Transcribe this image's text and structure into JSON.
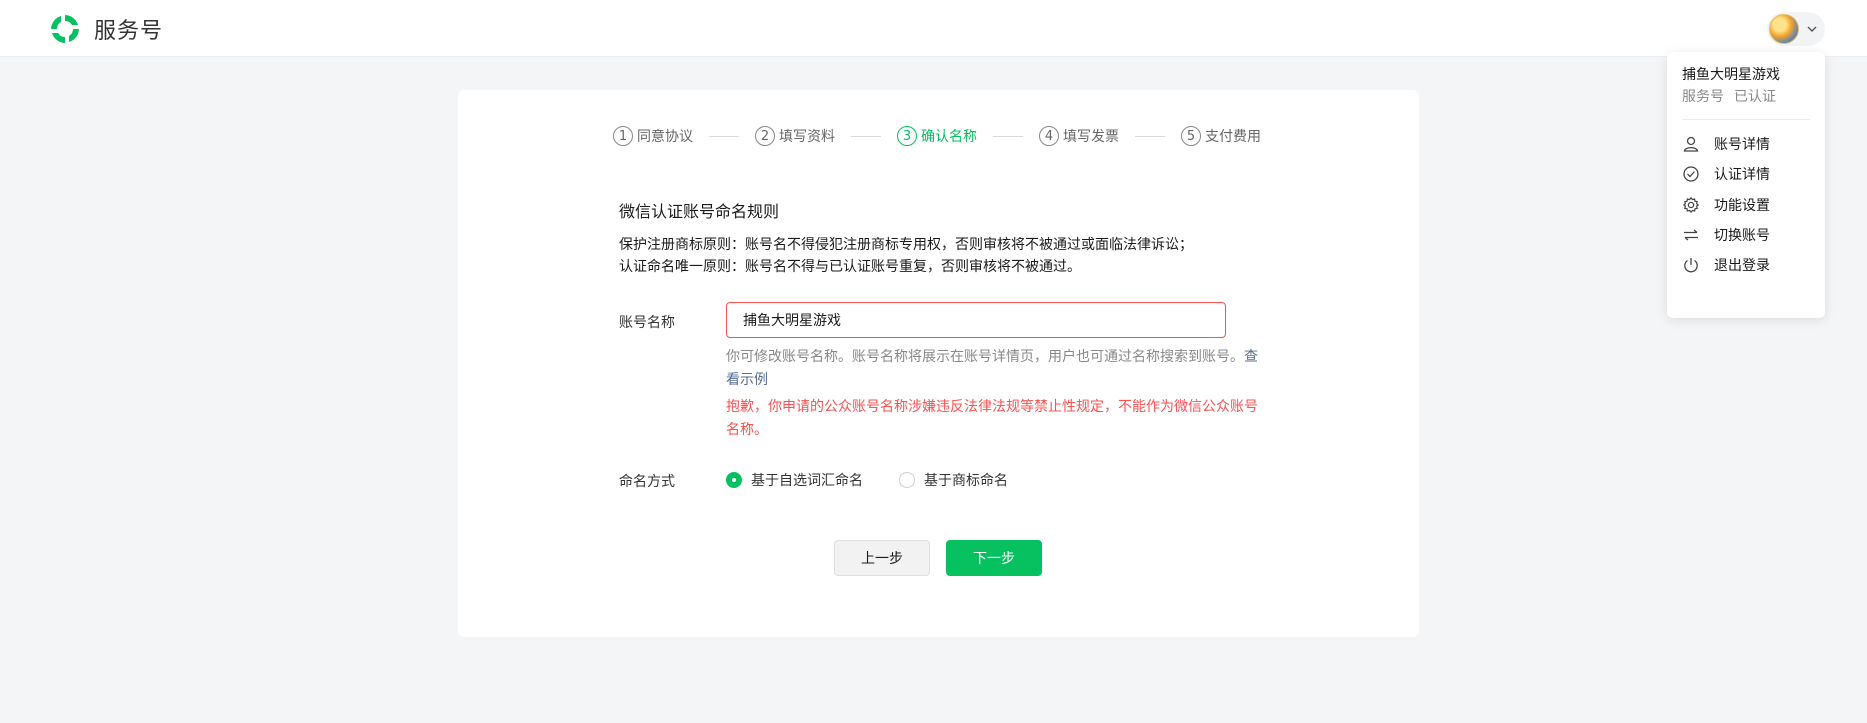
{
  "header": {
    "brand_name": "服务号"
  },
  "steps": [
    {
      "num": "1",
      "label": "同意协议",
      "active": false
    },
    {
      "num": "2",
      "label": "填写资料",
      "active": false
    },
    {
      "num": "3",
      "label": "确认名称",
      "active": true
    },
    {
      "num": "4",
      "label": "填写发票",
      "active": false
    },
    {
      "num": "5",
      "label": "支付费用",
      "active": false
    }
  ],
  "rules": {
    "title": "微信认证账号命名规则",
    "line1": "保护注册商标原则：账号名不得侵犯注册商标专用权，否则审核将不被通过或面临法律诉讼；",
    "line2": "认证命名唯一原则：账号名不得与已认证账号重复，否则审核将不被通过。"
  },
  "form": {
    "account_name_label": "账号名称",
    "account_name_value": "捕鱼大明星游戏",
    "hint_text": "你可修改账号名称。账号名称将展示在账号详情页，用户也可通过名称搜索到账号。",
    "hint_link": "查看示例",
    "error_text": "抱歉，你申请的公众账号名称涉嫌违反法律法规等禁止性规定，不能作为微信公众账号名称。",
    "naming_label": "命名方式",
    "naming_options": [
      {
        "label": "基于自选词汇命名",
        "checked": true
      },
      {
        "label": "基于商标命名",
        "checked": false
      }
    ]
  },
  "buttons": {
    "prev": "上一步",
    "next": "下一步"
  },
  "account_menu": {
    "account_name": "捕鱼大明星游戏",
    "account_type": "服务号",
    "status": "已认证",
    "items": [
      {
        "label": "账号详情",
        "icon": "user-icon"
      },
      {
        "label": "认证详情",
        "icon": "check-circle-icon"
      },
      {
        "label": "功能设置",
        "icon": "gear-icon"
      },
      {
        "label": "切换账号",
        "icon": "switch-icon"
      },
      {
        "label": "退出登录",
        "icon": "power-icon"
      }
    ]
  },
  "colors": {
    "primary": "#07c160",
    "error": "#fa5151",
    "link": "#576b95"
  }
}
